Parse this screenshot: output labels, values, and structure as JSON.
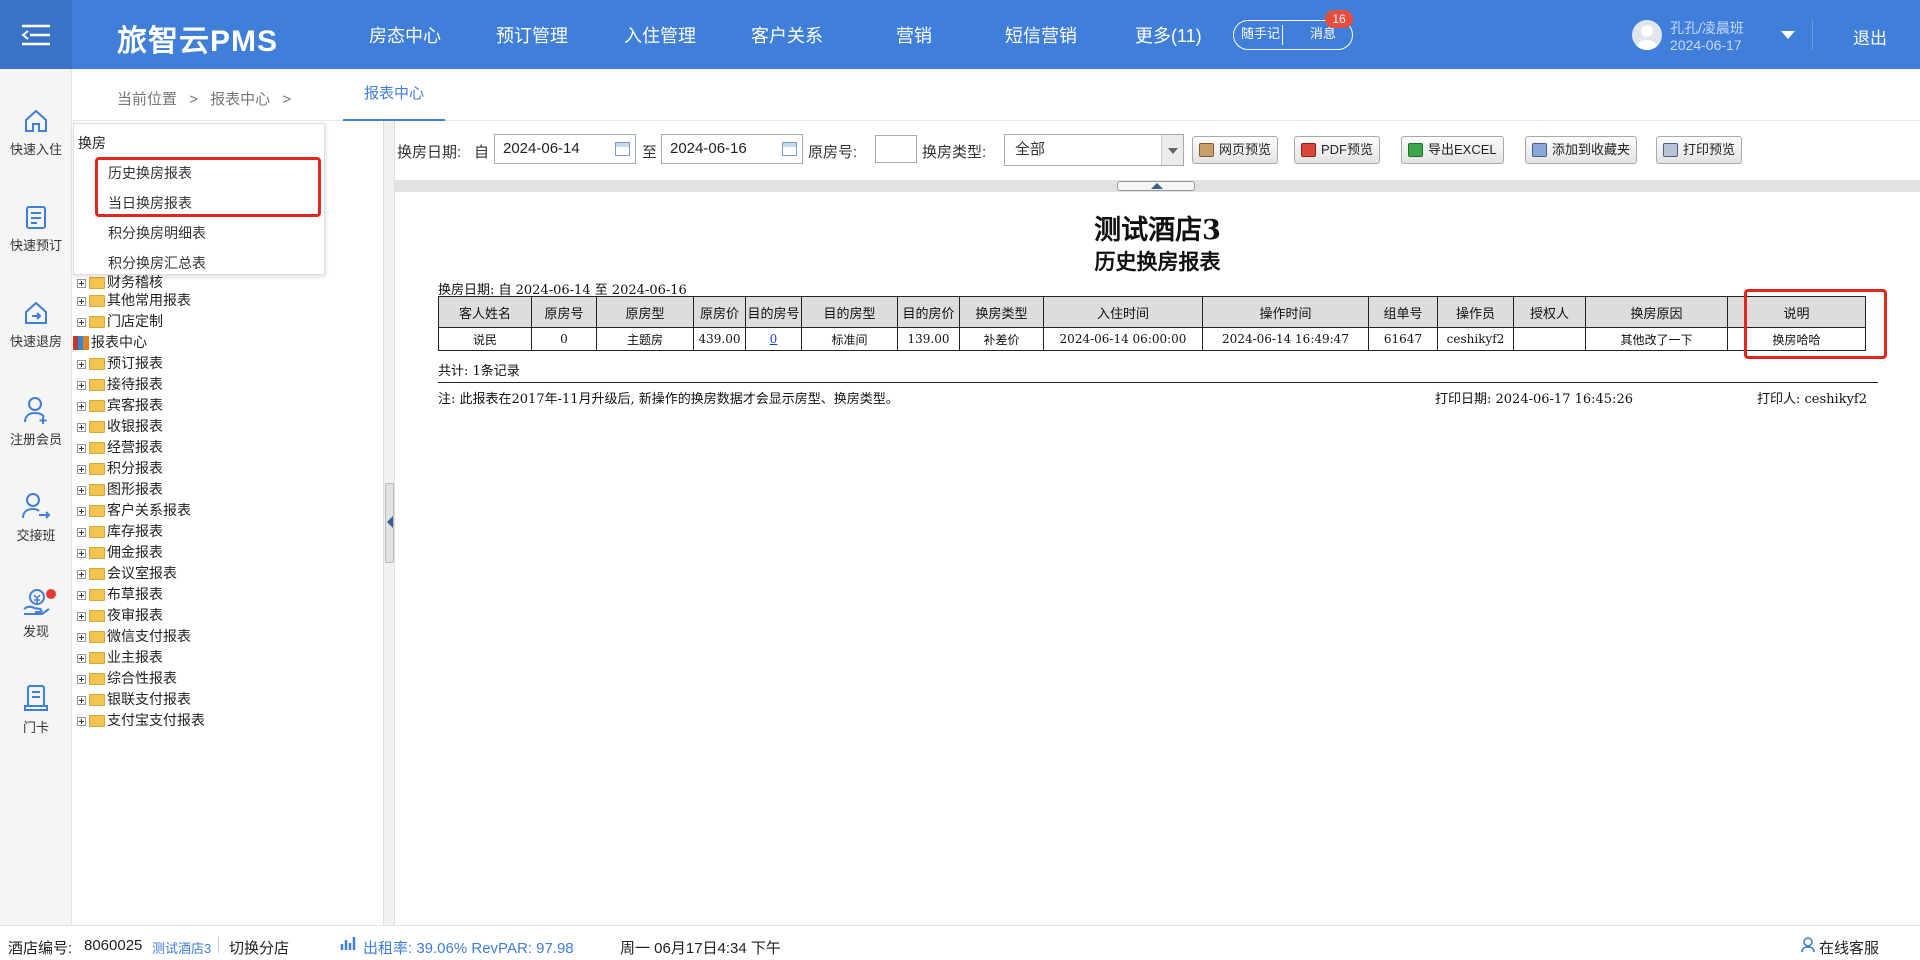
{
  "app": {
    "brand": "旅智云PMS"
  },
  "topnav": [
    "房态中心",
    "预订管理",
    "入住管理",
    "客户关系",
    "营销",
    "短信营销",
    "更多(11)"
  ],
  "pills": {
    "notes": "随手记",
    "messages": "消息",
    "badge": "16"
  },
  "user": {
    "name": "孔孔/凌晨班",
    "date": "2024-06-17",
    "logout": "退出"
  },
  "leftbar": [
    {
      "label": "快速入住",
      "icon": "home-icon"
    },
    {
      "label": "快速预订",
      "icon": "document-list-icon"
    },
    {
      "label": "快速退房",
      "icon": "checkout-icon"
    },
    {
      "label": "注册会员",
      "icon": "add-user-icon"
    },
    {
      "label": "交接班",
      "icon": "shift-handover-icon"
    },
    {
      "label": "发现",
      "icon": "discover-icon"
    },
    {
      "label": "门卡",
      "icon": "door-card-icon"
    }
  ],
  "breadcrumb": {
    "current_label": "当前位置",
    "sep": ">",
    "report_center": "报表中心",
    "sep2": ">"
  },
  "tab": {
    "active": "报表中心"
  },
  "popup": {
    "title": "换房",
    "items": [
      "历史换房报表",
      "当日换房报表",
      "积分换房明细表",
      "积分换房汇总表"
    ]
  },
  "tree": {
    "partial_item": "财务稽核",
    "items_before": [
      "其他常用报表",
      "门店定制"
    ],
    "root": "报表中心",
    "children": [
      "预订报表",
      "接待报表",
      "宾客报表",
      "收银报表",
      "经营报表",
      "积分报表",
      "图形报表",
      "客户关系报表",
      "库存报表",
      "佣金报表",
      "会议室报表",
      "布草报表",
      "夜审报表",
      "微信支付报表",
      "业主报表",
      "综合性报表",
      "银联支付报表",
      "支付宝支付报表"
    ]
  },
  "filters": {
    "date_label": "换房日期:",
    "from_label": "自",
    "from_value": "2024-06-14",
    "to_label": "至",
    "to_value": "2024-06-16",
    "room_label": "原房号:",
    "room_value": "",
    "type_label": "换房类型:",
    "type_value": "全部",
    "buttons": [
      "网页预览",
      "PDF预览",
      "导出EXCEL",
      "添加到收藏夹",
      "打印预览"
    ]
  },
  "report": {
    "hotel": "测试酒店3",
    "title": "历史换房报表",
    "range": "换房日期: 自 2024-06-14 至 2024-06-16",
    "columns": [
      "客人姓名",
      "原房号",
      "原房型",
      "原房价",
      "目的房号",
      "目的房型",
      "目的房价",
      "换房类型",
      "入住时间",
      "操作时间",
      "组单号",
      "操作员",
      "授权人",
      "换房原因",
      "说明"
    ],
    "rows": [
      [
        "说民",
        "0",
        "主题房",
        "439.00",
        "0",
        "标准间",
        "139.00",
        "补差价",
        "2024-06-14 06:00:00",
        "2024-06-14 16:49:47",
        "61647",
        "ceshikyf2",
        "",
        "其他改了一下",
        "换房哈哈"
      ]
    ],
    "total": "共计: 1条记录",
    "note": "注: 此报表在2017年-11月升级后, 新操作的换房数据才会显示房型、换房类型。",
    "print_date": "打印日期: 2024-06-17 16:45:26",
    "printer": "打印人: ceshikyf2"
  },
  "status": {
    "hotel_id_label": "酒店编号:",
    "hotel_id": "8060025",
    "hotel_name": "测试酒店3",
    "switch": "切换分店",
    "occupancy": "出租率: 39.06% RevPAR: 97.98",
    "datetime": "周一 06月17日4:34 下午",
    "support": "在线客服"
  },
  "colors": {
    "header": "#3f7ed9",
    "highlight": "#e4261f",
    "link": "#1a3fb8"
  }
}
